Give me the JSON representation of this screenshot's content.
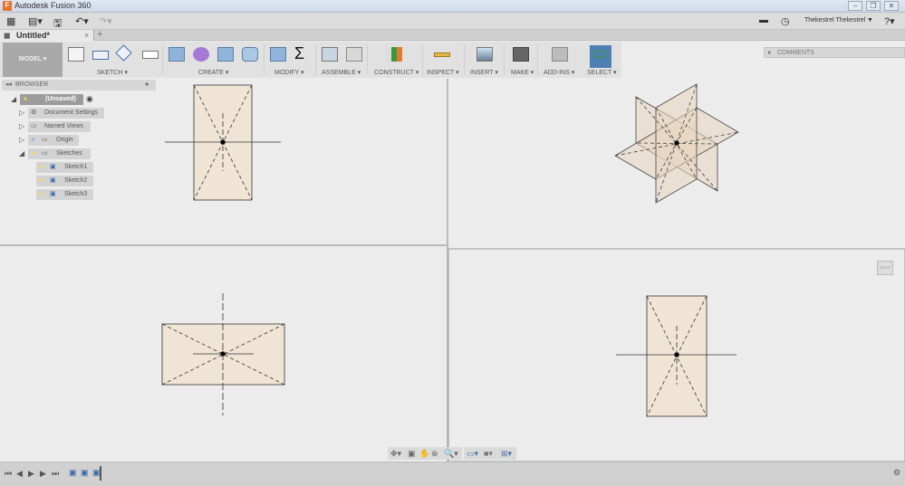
{
  "window": {
    "title": "Autodesk Fusion 360",
    "app_icon": "F"
  },
  "quick_access": {
    "user": "Thekestrel Thekestrel"
  },
  "tabs": [
    {
      "label": "Untitled*"
    }
  ],
  "toolbar": {
    "workspace": "MODEL ▾",
    "groups": [
      "SKETCH ▾",
      "CREATE ▾",
      "MODIFY ▾",
      "ASSEMBLE ▾",
      "CONSTRUCT ▾",
      "INSPECT ▾",
      "INSERT ▾",
      "MAKE ▾",
      "ADD-INS ▾",
      "SELECT ▾"
    ]
  },
  "comments": {
    "label": "COMMENTS"
  },
  "browser": {
    "title": "BROWSER",
    "items": [
      {
        "label": "(Unsaved)",
        "level": 0
      },
      {
        "label": "Document Settings",
        "level": 1
      },
      {
        "label": "Named Views",
        "level": 1
      },
      {
        "label": "Origin",
        "level": 1
      },
      {
        "label": "Sketches",
        "level": 1
      },
      {
        "label": "Sketch1",
        "level": 2
      },
      {
        "label": "Sketch2",
        "level": 2
      },
      {
        "label": "Sketch3",
        "level": 2
      }
    ]
  },
  "viewcube": {
    "label": "RIGHT"
  },
  "colors": {
    "select_active": "#4e7fb0",
    "sketch_fill": "#f0e4d4",
    "toolbar_bg": "#e1e1e1"
  }
}
